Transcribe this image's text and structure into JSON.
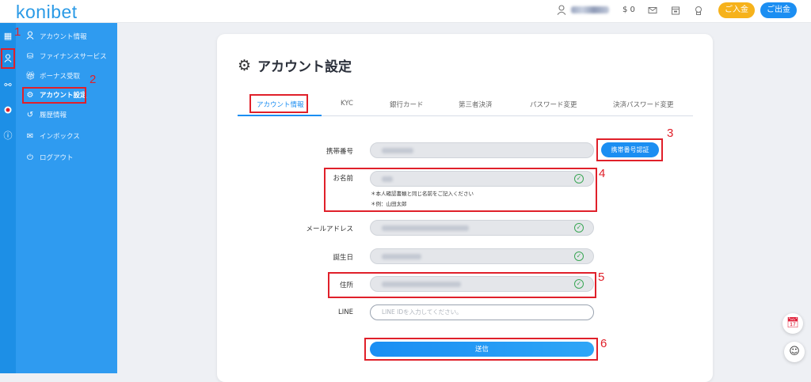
{
  "header": {
    "logo": "konibet",
    "balance": "$ 0",
    "deposit_label": "ご入金",
    "withdraw_label": "ご出金",
    "icons": [
      "user-icon",
      "mail-icon",
      "calendar-icon",
      "support-icon"
    ]
  },
  "rail": {
    "icons": [
      "grid-icon",
      "account-icon",
      "share-icon",
      "record-icon",
      "info-icon"
    ],
    "active_index": 1
  },
  "sidebar": {
    "items": [
      {
        "icon": "user-icon",
        "label": "アカウント情報"
      },
      {
        "icon": "finance-icon",
        "label": "ファイナンスサービス"
      },
      {
        "icon": "gift-icon",
        "label": "ボーナス受取"
      },
      {
        "icon": "gear-icon",
        "label": "アカウント設定"
      },
      {
        "icon": "history-icon",
        "label": "履歴情報"
      },
      {
        "icon": "mail-icon",
        "label": "インボックス"
      },
      {
        "icon": "logout-icon",
        "label": "ログアウト"
      }
    ],
    "active_index": 3
  },
  "page": {
    "title": "アカウント設定"
  },
  "tabs": [
    {
      "label": "アカウント情報",
      "active": true
    },
    {
      "label": "KYC"
    },
    {
      "label": "銀行カード"
    },
    {
      "label": "第三者決済"
    },
    {
      "label": "パスワード変更"
    },
    {
      "label": "決済パスワード変更"
    }
  ],
  "form": {
    "phone_label": "携帯番号",
    "verify_phone_label": "携帯番号認証",
    "name_label": "お名前",
    "name_hint_1": "＊本人確認書類と同じ名前をご記入ください",
    "name_hint_2": "＊例：山田太郎",
    "email_label": "メールアドレス",
    "birthday_label": "誕生日",
    "address_label": "住所",
    "line_label": "LINE",
    "line_placeholder": "LINE IDを入力してください。",
    "submit_label": "送信"
  },
  "annotations": [
    "1",
    "2",
    "3",
    "4",
    "5",
    "6"
  ],
  "colors": {
    "accent": "#1b8ef2",
    "sidebar": "#2f9bf0",
    "deposit": "#f6b21b",
    "annotation": "#e0202a",
    "verified": "#3aa655"
  }
}
